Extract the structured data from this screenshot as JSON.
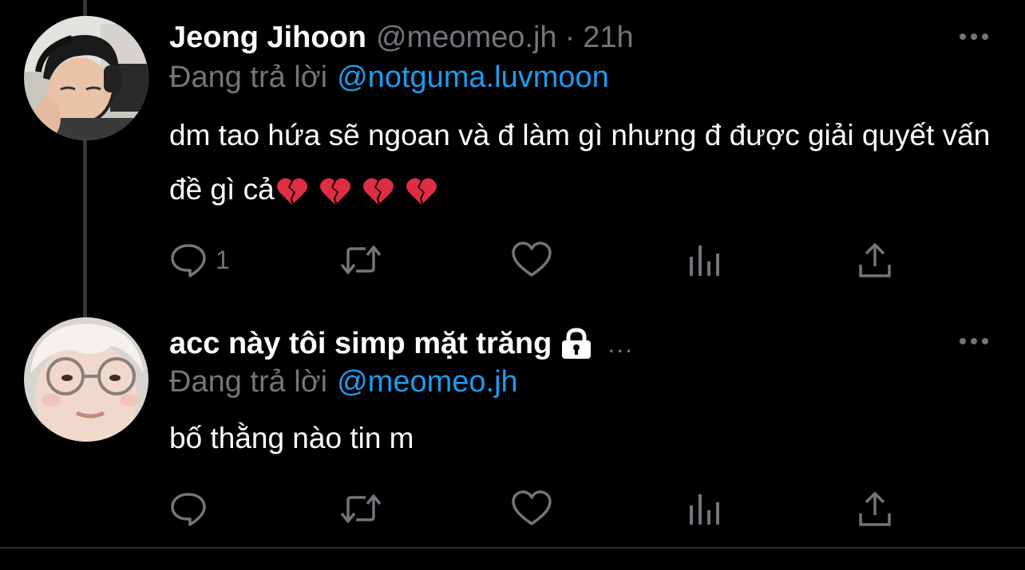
{
  "colors": {
    "background": "#000000",
    "text_primary": "#ffffff",
    "text_secondary": "#71767b",
    "link": "#1d9bf0",
    "broken_heart": "#dd2e44"
  },
  "tweets": [
    {
      "display_name": "Jeong Jihoon",
      "handle": "@meomeo.jh",
      "separator": "·",
      "time": "21h",
      "reply_prefix": "Đang trả lời",
      "reply_to": "@notguma.luvmoon",
      "text": "dm tao hứa sẽ ngoan và đ làm gì nhưng đ được giải quyết vấn đề gì cả",
      "emojis": [
        "broken-heart",
        "broken-heart",
        "broken-heart",
        "broken-heart"
      ],
      "reply_count": "1",
      "protected": false
    },
    {
      "display_name": "acc này tôi simp mặt trăng",
      "name_ellipsis": "...",
      "reply_prefix": "Đang trả lời",
      "reply_to": "@meomeo.jh",
      "text": "bố thằng nào tin m",
      "reply_count": "",
      "protected": true
    }
  ],
  "icons": {
    "more": "more-horizontal-icon",
    "lock": "lock-icon",
    "reply": "reply-icon",
    "retweet": "retweet-icon",
    "like": "heart-icon",
    "views": "views-icon",
    "share": "share-icon",
    "emoji": "broken-heart-icon"
  }
}
